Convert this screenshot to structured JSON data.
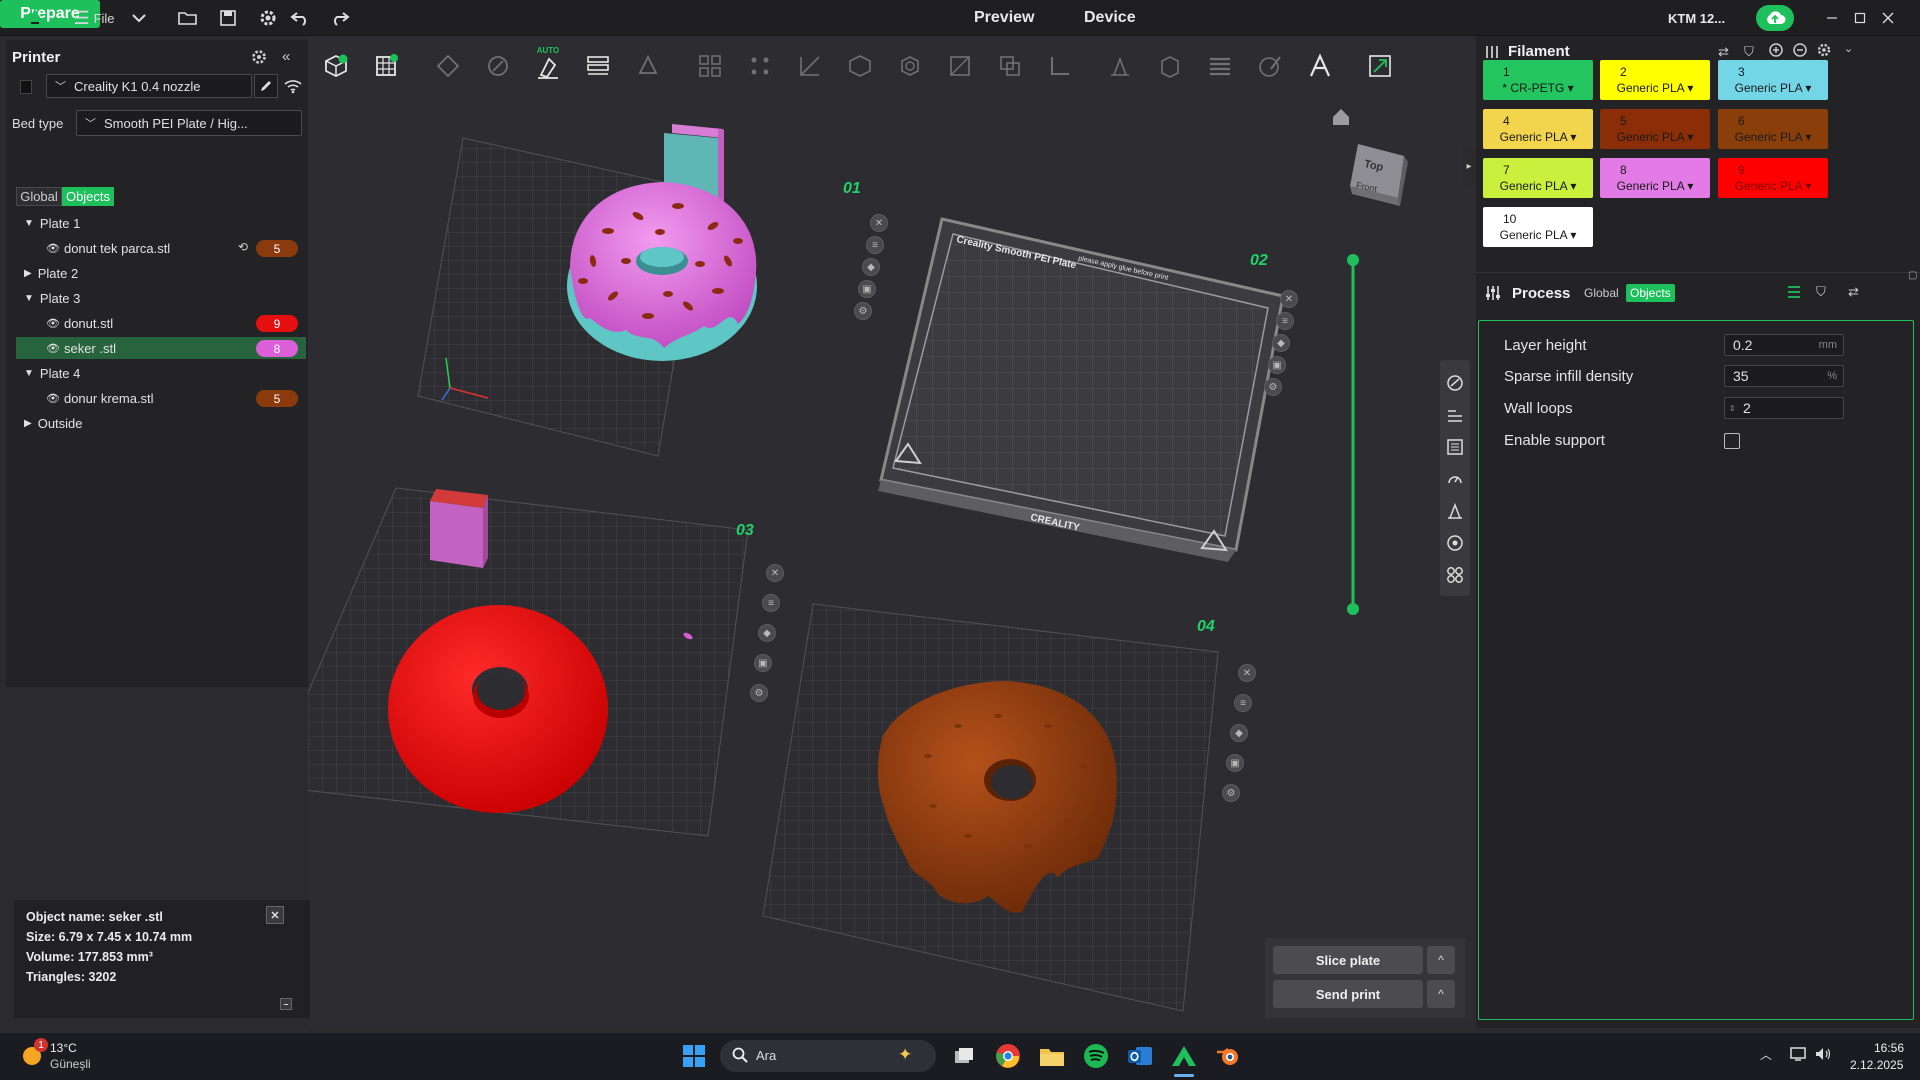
{
  "titlebar": {
    "file_label": "File",
    "tabs": [
      "Prepare",
      "Preview",
      "Device"
    ],
    "printer_short": "KTM 12..."
  },
  "printer": {
    "heading": "Printer",
    "preset": "Creality K1 0.4 nozzle",
    "bed_type_label": "Bed type",
    "bed_type_value": "Smooth PEI Plate / Hig...",
    "mode_tabs": [
      "Global",
      "Objects"
    ]
  },
  "tree": [
    {
      "label": "Plate 1",
      "kind": "plate"
    },
    {
      "label": "donut tek parca.stl",
      "kind": "object",
      "badge": "5",
      "badge_color": "#8b3a0e"
    },
    {
      "label": "Plate 2",
      "kind": "plate"
    },
    {
      "label": "Plate 3",
      "kind": "plate"
    },
    {
      "label": "donut.stl",
      "kind": "object",
      "badge": "9",
      "badge_color": "#e60f10"
    },
    {
      "label": "seker .stl",
      "kind": "object",
      "badge": "8",
      "badge_color": "#da5fd8",
      "selected": true
    },
    {
      "label": "Plate 4",
      "kind": "plate"
    },
    {
      "label": "donur krema.stl",
      "kind": "object",
      "badge": "5",
      "badge_color": "#8b3a0e"
    },
    {
      "label": "Outside",
      "kind": "plate"
    }
  ],
  "object_info": {
    "name": "Object name: seker .stl",
    "size": "Size: 6.79 x 7.45 x 10.74 mm",
    "volume": "Volume: 177.853 mm³",
    "triangles": "Triangles: 3202"
  },
  "toolbar": {
    "auto_label": "AUTO"
  },
  "plates": [
    {
      "num": "01"
    },
    {
      "num": "02"
    },
    {
      "num": "03"
    },
    {
      "num": "04"
    }
  ],
  "bed_texts": {
    "title": "Creality Smooth PEI Plate",
    "note": "please apply glue before print",
    "brand": "CREALITY"
  },
  "view_cube": {
    "top": "Top",
    "front": "Front"
  },
  "filament": {
    "heading": "Filament",
    "slots": [
      {
        "num": "1",
        "name": "* CR-PETG",
        "color": "#22c55e",
        "text": "#1a1a1a"
      },
      {
        "num": "2",
        "name": "Generic PLA",
        "color": "#ffff00",
        "text": "#1a1a1a"
      },
      {
        "num": "3",
        "name": "Generic PLA",
        "color": "#72d6e6",
        "text": "#1a1a1a"
      },
      {
        "num": "4",
        "name": "Generic PLA",
        "color": "#f3d44d",
        "text": "#1a1a1a"
      },
      {
        "num": "5",
        "name": "Generic PLA",
        "color": "#8b2d06",
        "text": "#1a1a1a"
      },
      {
        "num": "6",
        "name": "Generic PLA",
        "color": "#8a3f0a",
        "text": "#1a1a1a"
      },
      {
        "num": "7",
        "name": "Generic PLA",
        "color": "#c8f03c",
        "text": "#1a1a1a"
      },
      {
        "num": "8",
        "name": "Generic PLA",
        "color": "#e27be6",
        "text": "#1a1a1a"
      },
      {
        "num": "9",
        "name": "Generic PLA",
        "color": "#ff0000",
        "text": "#7a0000"
      },
      {
        "num": "10",
        "name": "Generic PLA",
        "color": "#ffffff",
        "text": "#1a1a1a"
      }
    ]
  },
  "process": {
    "heading": "Process",
    "mode_tabs": [
      "Global",
      "Objects"
    ],
    "params": [
      {
        "label": "Layer height",
        "value": "0.2",
        "unit": "mm"
      },
      {
        "label": "Sparse infill density",
        "value": "35",
        "unit": "%"
      },
      {
        "label": "Wall loops",
        "value": "2",
        "unit": ""
      },
      {
        "label": "Enable support",
        "value": "",
        "unit": ""
      }
    ]
  },
  "actions": {
    "slice": "Slice plate",
    "send": "Send print"
  },
  "taskbar": {
    "temp": "13°C",
    "weather": "Güneşli",
    "weather_badge": "1",
    "search": "Ara",
    "time": "16:56",
    "date": "2.12.2025"
  },
  "colors": {
    "accent": "#1ec05c",
    "selected_row": "#27633d"
  }
}
